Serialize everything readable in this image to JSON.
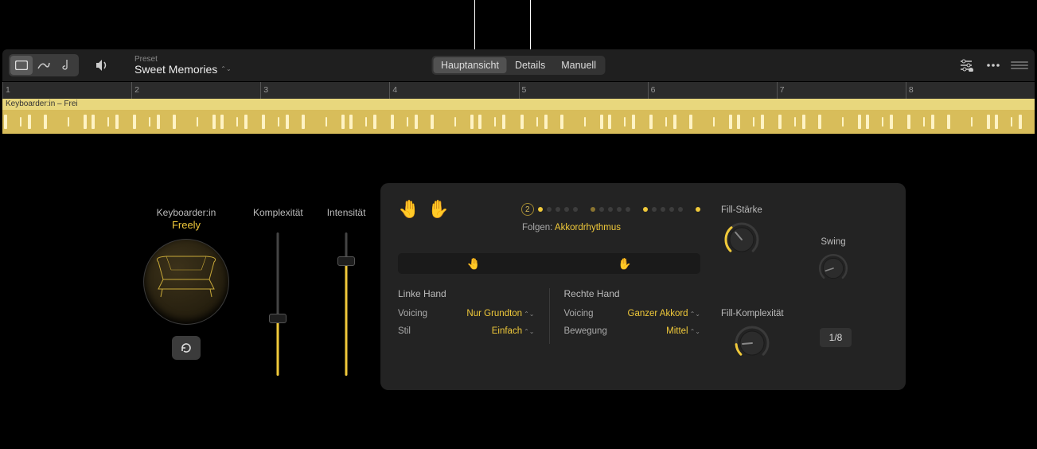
{
  "toolbar": {
    "preset_label": "Preset",
    "preset_name": "Sweet Memories",
    "tabs": {
      "main": "Hauptansicht",
      "details": "Details",
      "manual": "Manuell"
    }
  },
  "ruler": {
    "bars": [
      "1",
      "2",
      "3",
      "4",
      "5",
      "6",
      "7",
      "8"
    ]
  },
  "region": {
    "name": "Keyboarder:in – Frei"
  },
  "player": {
    "role": "Keyboarder:in",
    "name": "Freely",
    "complexity_label": "Komplexität",
    "complexity_value": 40,
    "intensity_label": "Intensität",
    "intensity_value": 80
  },
  "panel": {
    "beat_count": "2",
    "beat_dots": [
      "on",
      "off",
      "off",
      "off",
      "off",
      "half",
      "off",
      "off",
      "off",
      "off",
      "on",
      "off",
      "off",
      "off",
      "off",
      "on"
    ],
    "follow_label": "Folgen:",
    "follow_value": "Akkordrhythmus",
    "left": {
      "title": "Linke Hand",
      "voicing_label": "Voicing",
      "voicing_value": "Nur Grundton",
      "style_label": "Stil",
      "style_value": "Einfach"
    },
    "right": {
      "title": "Rechte Hand",
      "voicing_label": "Voicing",
      "voicing_value": "Ganzer Akkord",
      "movement_label": "Bewegung",
      "movement_value": "Mittel"
    },
    "knobs": {
      "fill_amount": "Fill-Stärke",
      "fill_complexity": "Fill-Komplexität",
      "swing": "Swing",
      "swing_value": "1/8"
    }
  },
  "icons": {
    "view": "rect",
    "curve": "curve",
    "note": "note",
    "volume": "volume",
    "settings": "sliders",
    "more": "dots"
  }
}
